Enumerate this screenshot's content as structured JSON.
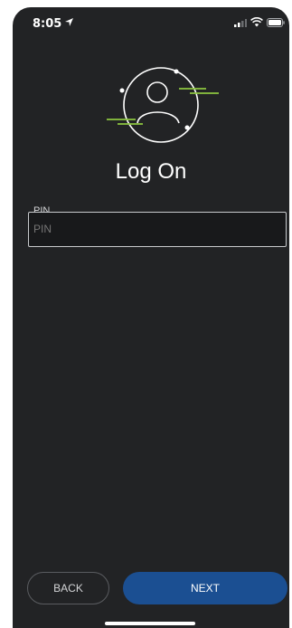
{
  "status_bar": {
    "time": "8:05",
    "icons": [
      "location-arrow-icon",
      "signal-icon",
      "wifi-icon",
      "battery-icon"
    ]
  },
  "screen": {
    "title": "Log On",
    "logo_icon": "user-circle-icon",
    "accent_color": "#8dc63f",
    "background_color": "#222325"
  },
  "pin_field": {
    "label": "PIN",
    "placeholder": "PIN",
    "value": ""
  },
  "buttons": {
    "back_label": "BACK",
    "next_label": "NEXT",
    "next_color": "#1b4f92"
  }
}
